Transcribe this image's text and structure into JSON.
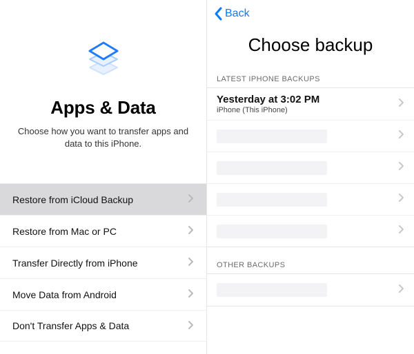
{
  "left": {
    "title": "Apps & Data",
    "subtitle": "Choose how you want to transfer apps and data to this iPhone.",
    "options": [
      {
        "label": "Restore from iCloud Backup",
        "selected": true
      },
      {
        "label": "Restore from Mac or PC",
        "selected": false
      },
      {
        "label": "Transfer Directly from iPhone",
        "selected": false
      },
      {
        "label": "Move Data from Android",
        "selected": false
      },
      {
        "label": "Don't Transfer Apps & Data",
        "selected": false
      }
    ]
  },
  "right": {
    "back_label": "Back",
    "title": "Choose backup",
    "section_latest": "LATEST IPHONE BACKUPS",
    "section_other": "OTHER BACKUPS",
    "latest_backups": [
      {
        "title": "Yesterday at 3:02 PM",
        "subtitle": "iPhone (This iPhone)",
        "placeholder": false
      },
      {
        "title": "",
        "subtitle": "",
        "placeholder": true
      },
      {
        "title": "",
        "subtitle": "",
        "placeholder": true
      },
      {
        "title": "",
        "subtitle": "",
        "placeholder": true
      },
      {
        "title": "",
        "subtitle": "",
        "placeholder": true
      }
    ],
    "other_backups": [
      {
        "title": "",
        "subtitle": "",
        "placeholder": true
      }
    ]
  },
  "colors": {
    "accent": "#0a7aff"
  }
}
